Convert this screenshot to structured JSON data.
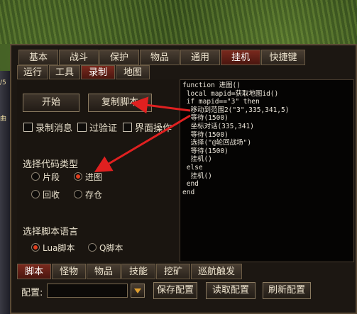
{
  "background": {
    "left_text_1": "/5",
    "left_text_2": "曲"
  },
  "top_tabs": [
    {
      "label": "基本",
      "active": false
    },
    {
      "label": "战斗",
      "active": false
    },
    {
      "label": "保护",
      "active": false
    },
    {
      "label": "物品",
      "active": false
    },
    {
      "label": "通用",
      "active": false
    },
    {
      "label": "挂机",
      "active": true
    },
    {
      "label": "快捷键",
      "active": false
    }
  ],
  "sub_tabs": [
    {
      "label": "运行",
      "active": false
    },
    {
      "label": "工具",
      "active": false
    },
    {
      "label": "录制",
      "active": true
    },
    {
      "label": "地图",
      "active": false
    }
  ],
  "buttons": {
    "start": "开始",
    "copy_script": "复制脚本"
  },
  "checkboxes": [
    {
      "label": "录制消息",
      "checked": false
    },
    {
      "label": "过验证",
      "checked": false
    },
    {
      "label": "界面操作",
      "checked": false
    }
  ],
  "code_type": {
    "title": "选择代码类型",
    "options": [
      {
        "label": "片段",
        "selected": false
      },
      {
        "label": "进图",
        "selected": true
      },
      {
        "label": "回收",
        "selected": false
      },
      {
        "label": "存仓",
        "selected": false
      }
    ]
  },
  "script_lang": {
    "title": "选择脚本语言",
    "options": [
      {
        "label": "Lua脚本",
        "selected": true
      },
      {
        "label": "Q脚本",
        "selected": false
      }
    ]
  },
  "code_text": "function 进图()\n local mapid=获取地图id()\n if mapid==\"3\" then\n  移动到范围2(\"3\",335,341,5)\n  等待(1500)\n  坐标对话(335,341)\n  等待(1500)\n  选择(\"@轮回战场\")\n  等待(1500)\n  挂机()\n else\n  挂机()\n end\nend",
  "bottom_tabs": [
    {
      "label": "脚本",
      "active": true
    },
    {
      "label": "怪物",
      "active": false
    },
    {
      "label": "物品",
      "active": false
    },
    {
      "label": "技能",
      "active": false
    },
    {
      "label": "挖矿",
      "active": false
    },
    {
      "label": "巡航触发",
      "active": false
    }
  ],
  "config": {
    "label": "配置:",
    "value": "",
    "save": "保存配置",
    "load": "读取配置",
    "refresh": "刷新配置"
  },
  "colors": {
    "active_tab": "#7a2a1e",
    "annotation_arrow": "#e02020",
    "radio_on": "#e04020"
  }
}
